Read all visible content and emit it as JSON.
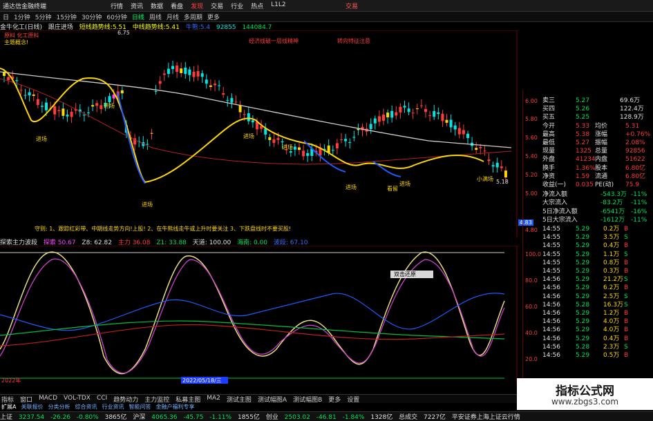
{
  "window": {
    "title": "通达信金融终端",
    "menu": [
      "行情",
      "资讯",
      "数据",
      "看盘",
      "发现",
      "交易",
      "行业",
      "热点",
      "L1L2"
    ],
    "trade": "交易"
  },
  "toolbar": {
    "items": [
      "日",
      "1分钟",
      "5分钟",
      "15分钟",
      "30分钟",
      "60分钟",
      "日线",
      "周线",
      "月线",
      "多周期",
      "更多"
    ],
    "selected": "日线"
  },
  "info": {
    "stock": "金牛化工(日线)",
    "ind1": "跟庄进场",
    "ind2": "短线趋势线:5.51",
    "ind3": "中线趋势线:5.41",
    "ind4": "牛熊:5.4",
    "v1": "92855",
    "v2": "144084.7"
  },
  "main": {
    "label_top": "原料 化工原料",
    "label_tag": "主题概念!",
    "price_high": "6.75",
    "price_low": "4.83",
    "price_mid": "5.18",
    "note1": "经济线破一层线精神",
    "note2": "转向特征注意",
    "note_bottom": "守则: 1、跟踪红彩带、中期线走势方向!上股! 2、在牛熊线走牛或上升时要关注 3、下跌盘线时不要买股!",
    "axis": [
      "6.00",
      "5.80",
      "5.60",
      "5.40",
      "5.20",
      "5.00",
      "4.80"
    ],
    "tags": [
      "进场",
      "进场",
      "进场",
      "进场",
      "进场",
      "进场",
      "进场",
      "看留",
      "小满场"
    ]
  },
  "sub": {
    "title": "探索主力波段",
    "v": "探索 50.67",
    "z": "Z8: 62.82",
    "a": "主力 36.08",
    "z1": "Z1: 33.88",
    "tian": "天道: 100.00",
    "hai": "海南: 0.00",
    "extra": "波段: 67.10",
    "axis": [
      "100.0",
      "80.0",
      "60.0",
      "40.0",
      "20.0"
    ],
    "date_left": "2022年",
    "date_mid": "2022/05/18/三",
    "popup": "双击还原"
  },
  "quote": {
    "rows": [
      {
        "k": "卖三",
        "v": "5.27",
        "n": "69.6万"
      },
      {
        "k": "买四",
        "v": "5.26",
        "n": "122.4万"
      },
      {
        "k": "买五",
        "v": "5.25",
        "n": "128.9万"
      },
      {
        "k": "今开",
        "v": "5.33",
        "k2": "均价",
        "v2": "5.31"
      },
      {
        "k": "最高",
        "v": "5.38",
        "k2": "涨幅",
        "v2": "+0.76%"
      },
      {
        "k": "最低",
        "v": "5.27",
        "k2": "振幅",
        "v2": "2.08%"
      },
      {
        "k": "现量",
        "v": "1325",
        "k2": "总量",
        "v2": "92856"
      },
      {
        "k": "外盘",
        "v": "41234",
        "k2": "内盘",
        "v2": "51622"
      },
      {
        "k": "换手",
        "v": "1.36%",
        "k2": "股本",
        "v2": "6.80亿"
      },
      {
        "k": "净资",
        "v": "1.59",
        "k2": "流通",
        "v2": "6.80亿"
      },
      {
        "k": "收益(一)",
        "v": "0.035",
        "k2": "PE(动)",
        "v2": "75.9"
      }
    ],
    "flows": [
      {
        "k": "净流入额",
        "v": "-543.3万",
        "p": "-11%"
      },
      {
        "k": "大宗流入",
        "v": "-83.2万",
        "p": "-11%"
      },
      {
        "k": "5日净流入额",
        "v": "-6541万",
        "p": "-16%"
      },
      {
        "k": "5日大宗流入",
        "v": "-1612万",
        "p": "-11%"
      }
    ],
    "ticks": [
      {
        "t": "14:55",
        "p": "5.29",
        "v": "0.2万",
        "f": "B"
      },
      {
        "t": "14:55",
        "p": "5.29",
        "v": "3.5万",
        "f": "S"
      },
      {
        "t": "14:55",
        "p": "5.29",
        "v": "0.4万",
        "f": "B"
      },
      {
        "t": "14:55",
        "p": "5.29",
        "v": "1.1万",
        "f": "S"
      },
      {
        "t": "14:55",
        "p": "5.29",
        "v": "0.8万",
        "f": "B"
      },
      {
        "t": "14:55",
        "p": "5.29",
        "v": "0.3万",
        "f": "B"
      },
      {
        "t": "14:56",
        "p": "5.29",
        "v": "21.2万",
        "f": "S"
      },
      {
        "t": "14:56",
        "p": "5.29",
        "v": "6.2万",
        "f": "B"
      },
      {
        "t": "14:56",
        "p": "5.29",
        "v": "2.5万",
        "f": "S"
      },
      {
        "t": "14:56",
        "p": "5.28",
        "v": "16.3万",
        "f": "S"
      },
      {
        "t": "14:56",
        "p": "5.29",
        "v": "1.2万",
        "f": "B"
      },
      {
        "t": "14:56",
        "p": "5.29",
        "v": "4.0万",
        "f": "B"
      },
      {
        "t": "14:56",
        "p": "5.29",
        "v": "4.0万",
        "f": "B"
      },
      {
        "t": "14:56",
        "p": "5.29",
        "v": "0.4万",
        "f": "B"
      },
      {
        "t": "14:56",
        "p": "5.28",
        "v": "2.3万",
        "f": "S"
      },
      {
        "t": "14:56",
        "p": "5.29",
        "v": "0.5万",
        "f": "B"
      }
    ]
  },
  "tabs": [
    "指标",
    "窗口",
    "MACD",
    "VOL-TDX",
    "CCI",
    "趋势动力",
    "主力监控",
    "私募主图",
    "MA2",
    "测试主图",
    "测试幅图A",
    "测试幅图B",
    "更多",
    "设置"
  ],
  "tabs2": [
    "扩展A",
    "关联报价",
    "分类分析",
    "综合资讯",
    "行业资讯",
    "智能问答",
    "金融户福利专享"
  ],
  "status": {
    "sh": "上证",
    "sh_v": "3237.54",
    "sh_c": "-26.26",
    "sh_p": "-0.80%",
    "sh_a": "3865亿",
    "sz": "沪深",
    "sz_v": "4065.36",
    "sz_c": "-45.75",
    "sz_p": "-1.11%",
    "sz_a": "1855亿",
    "cy": "创业",
    "cy_v": "2503.02",
    "cy_c": "-46.81",
    "cy_p": "-1.84%",
    "cy_a": "1328亿",
    "tot": "总成交",
    "tot_v": "7227亿",
    "broker": "平安证券上海上证云行情"
  },
  "watermark": {
    "l1": "指标公式网",
    "l2": "www.zbgs3.com"
  },
  "colors": {
    "up": "#ff3b3b",
    "down": "#00e6e6",
    "bull": "#ffd700",
    "bear": "#1e5cff",
    "band": "#e0796a"
  }
}
